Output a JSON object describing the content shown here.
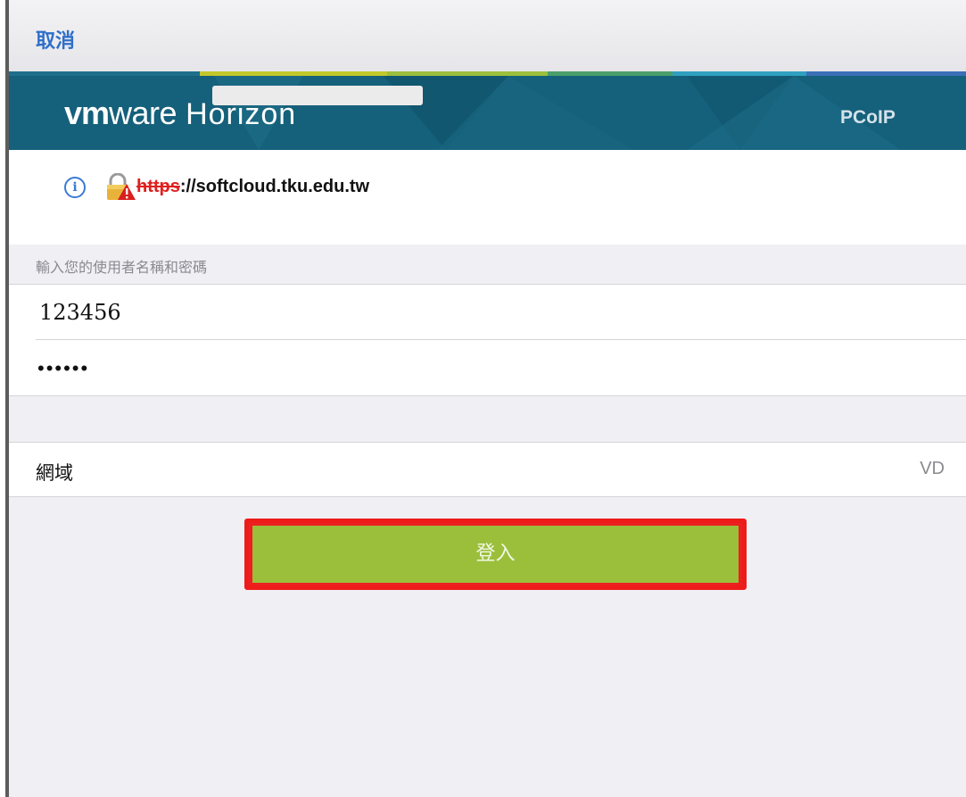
{
  "nav": {
    "cancel_label": "取消"
  },
  "banner": {
    "logo_vm": "vm",
    "logo_ware": "ware",
    "logo_product": "Horizon",
    "pcoip_label": "PCoIP",
    "stripe_colors": [
      "#1f6f8c",
      "#2e8c6c",
      "#c3c82a",
      "#9cc03c",
      "#4a9e6a",
      "#2fa0c0",
      "#3b6fb8"
    ]
  },
  "server": {
    "url_scheme": "https",
    "url_rest": "://softcloud.tku.edu.tw",
    "info_icon": "info-icon",
    "lock_icon": "lock-warning-icon"
  },
  "form": {
    "prompt": "輸入您的使用者名稱和密碼",
    "username_value": "123456",
    "password_value": "••••••",
    "domain_label": "網域",
    "domain_value": "VD",
    "login_label": "登入"
  },
  "colors": {
    "accent_blue": "#2f6fc9",
    "banner_bg": "#15607a",
    "login_green": "#9bbf3b",
    "highlight_red": "#ee1b1b"
  }
}
